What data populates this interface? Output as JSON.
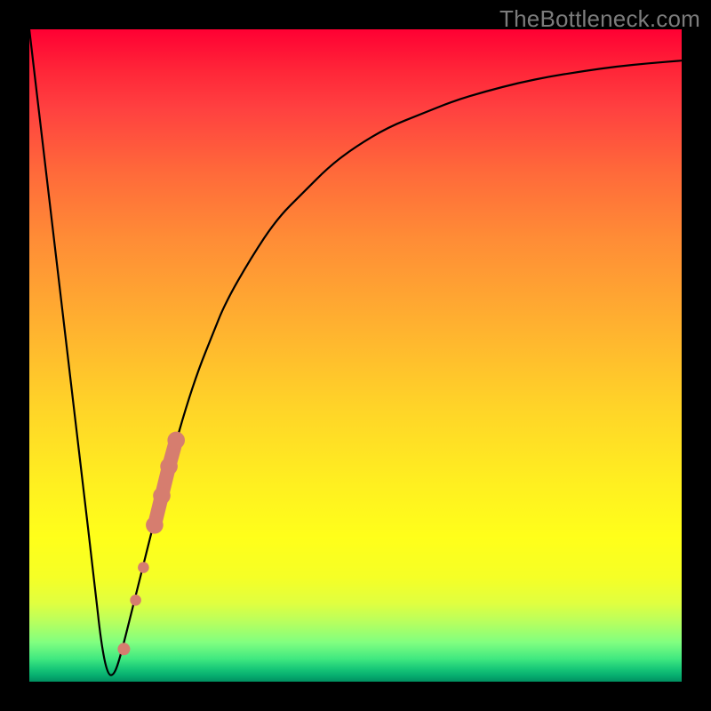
{
  "watermark": "TheBottleneck.com",
  "colors": {
    "frame": "#000000",
    "curve_stroke": "#000000",
    "marker_fill": "#d67d6f",
    "gradient_top": "#ff0033",
    "gradient_mid": "#ffd428",
    "gradient_bottom": "#009060"
  },
  "chart_data": {
    "type": "line",
    "title": "",
    "xlabel": "",
    "ylabel": "",
    "xlim": [
      0,
      100
    ],
    "ylim": [
      0,
      100
    ],
    "x": [
      0,
      2,
      4,
      6,
      8,
      10,
      11,
      12,
      13,
      14,
      16,
      18,
      20,
      22,
      24,
      26,
      28,
      30,
      34,
      38,
      42,
      46,
      50,
      55,
      60,
      65,
      70,
      75,
      80,
      85,
      90,
      95,
      100
    ],
    "values": [
      100,
      83,
      66,
      49,
      32,
      15,
      6,
      1,
      1,
      4,
      12,
      20,
      28,
      35,
      42,
      48,
      53,
      58,
      65,
      71,
      75,
      79,
      82,
      85,
      87,
      89,
      90.5,
      91.8,
      92.8,
      93.6,
      94.3,
      94.8,
      95.2
    ],
    "note": "y is bottleneck/deviation percent; curve dips to ~0 near x≈12 then asymptotically rises; values estimated from pixel positions against a 0–100 vertical scale",
    "markers": [
      {
        "x": 14.5,
        "y": 5.0,
        "size": 1.0
      },
      {
        "x": 16.3,
        "y": 12.5,
        "size": 0.9
      },
      {
        "x": 17.5,
        "y": 17.5,
        "size": 0.9
      },
      {
        "x": 19.2,
        "y": 24.0,
        "size": 1.4
      },
      {
        "x": 20.3,
        "y": 28.5,
        "size": 1.4
      },
      {
        "x": 21.4,
        "y": 33.0,
        "size": 1.4
      },
      {
        "x": 22.5,
        "y": 37.0,
        "size": 1.4
      }
    ]
  }
}
